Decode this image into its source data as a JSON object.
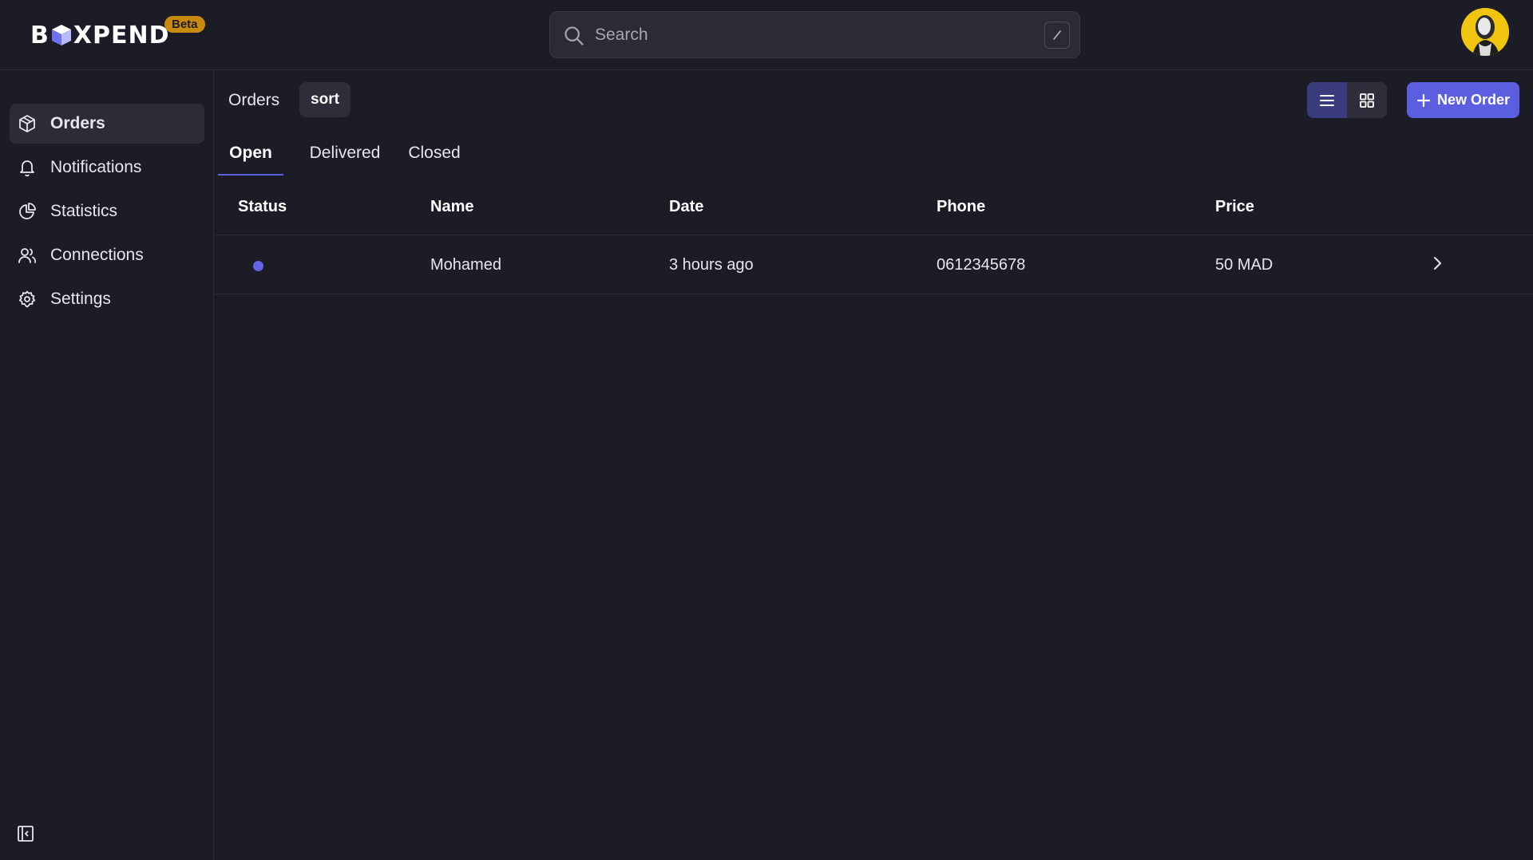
{
  "header": {
    "brand": {
      "prefix": "B",
      "suffix": "XPEND"
    },
    "beta_badge": "Beta",
    "search": {
      "placeholder": "Search",
      "value": "",
      "shortcut_icon": "slash-key-icon"
    },
    "avatar_icon": "user-avatar"
  },
  "sidebar": {
    "items": [
      {
        "label": "Orders",
        "icon": "box-icon",
        "active": true
      },
      {
        "label": "Notifications",
        "icon": "bell-icon",
        "active": false
      },
      {
        "label": "Statistics",
        "icon": "pie-chart-icon",
        "active": false
      },
      {
        "label": "Connections",
        "icon": "users-icon",
        "active": false
      },
      {
        "label": "Settings",
        "icon": "gear-icon",
        "active": false
      }
    ],
    "collapse_icon": "sidebar-collapse-icon"
  },
  "main": {
    "breadcrumb": "Orders",
    "sort_label": "sort",
    "view_modes": [
      "list",
      "grid"
    ],
    "active_view": "list",
    "new_order_label": "New Order",
    "tabs": [
      {
        "label": "Open",
        "active": true
      },
      {
        "label": "Delivered",
        "active": false
      },
      {
        "label": "Closed",
        "active": false
      }
    ],
    "table": {
      "columns": [
        "Status",
        "Name",
        "Date",
        "Phone",
        "Price"
      ],
      "rows": [
        {
          "status_color": "#6264e6",
          "name": "Mohamed",
          "date": "3 hours ago",
          "phone": "0612345678",
          "price": "50 MAD"
        }
      ]
    }
  },
  "colors": {
    "background": "#1b1c26",
    "accent": "#5c5ee0",
    "beta": "#c98a10",
    "avatar_bg": "#f1c40f"
  }
}
